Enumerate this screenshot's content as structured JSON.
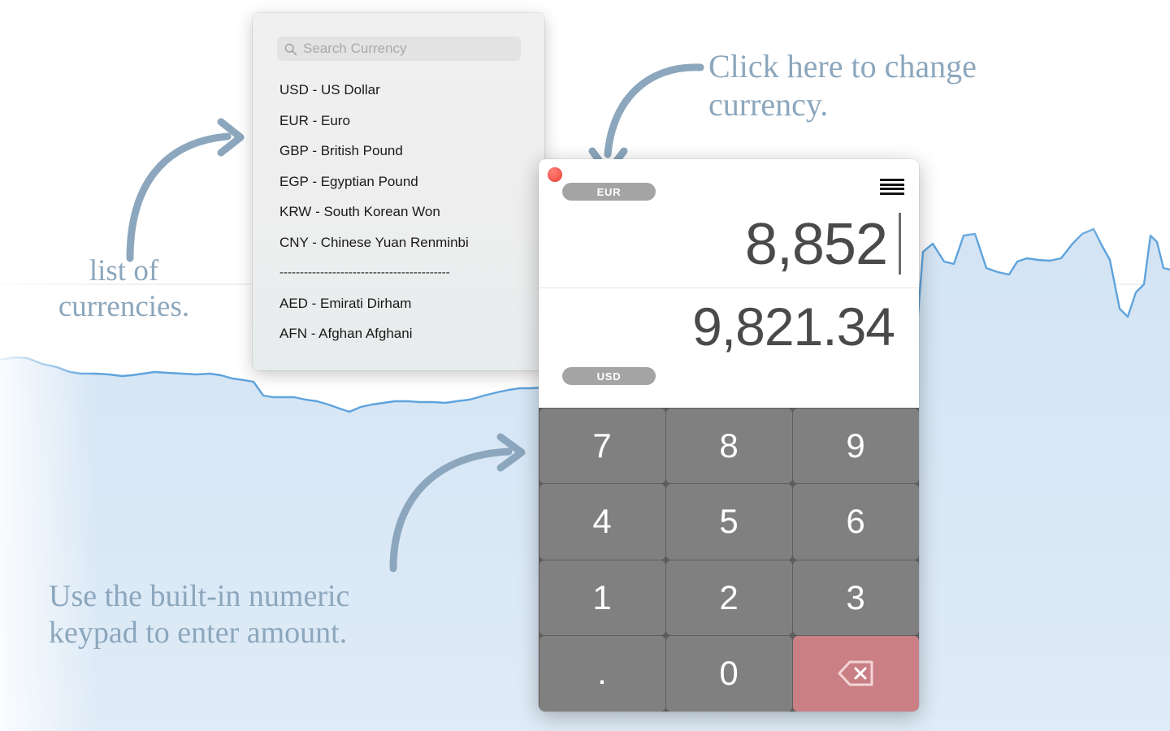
{
  "annotations": {
    "change_currency": "Click here to change\ncurrency.",
    "list_of_currencies": "list of\ncurrencies.",
    "keypad_hint": "Use the built-in numeric\nkeypad to enter amount.",
    "color": "#8ca7bd"
  },
  "popover": {
    "search": {
      "placeholder": "Search Currency",
      "value": "",
      "icon": "search-icon"
    },
    "items": [
      {
        "code": "USD",
        "label": "USD - US Dollar"
      },
      {
        "code": "EUR",
        "label": "EUR - Euro"
      },
      {
        "code": "GBP",
        "label": "GBP - British Pound"
      },
      {
        "code": "EGP",
        "label": "EGP - Egyptian Pound"
      },
      {
        "code": "KRW",
        "label": "KRW - South Korean Won"
      },
      {
        "code": "CNY",
        "label": "CNY - Chinese Yuan Renminbi"
      }
    ],
    "separator": "------------------------------------------",
    "items_after": [
      {
        "code": "AED",
        "label": "AED - Emirati Dirham"
      },
      {
        "code": "AFN",
        "label": "AFN - Afghan Afghani"
      }
    ]
  },
  "app": {
    "close_button": "close-button",
    "menu_icon": "hamburger-menu-icon",
    "top_currency": "EUR",
    "bottom_currency": "USD",
    "top_amount": "8,852",
    "bottom_amount": "9,821.34",
    "keypad": [
      {
        "name": "key-7",
        "label": "7",
        "type": "digit"
      },
      {
        "name": "key-8",
        "label": "8",
        "type": "digit"
      },
      {
        "name": "key-9",
        "label": "9",
        "type": "digit"
      },
      {
        "name": "key-4",
        "label": "4",
        "type": "digit"
      },
      {
        "name": "key-5",
        "label": "5",
        "type": "digit"
      },
      {
        "name": "key-6",
        "label": "6",
        "type": "digit"
      },
      {
        "name": "key-1",
        "label": "1",
        "type": "digit"
      },
      {
        "name": "key-2",
        "label": "2",
        "type": "digit"
      },
      {
        "name": "key-3",
        "label": "3",
        "type": "digit"
      },
      {
        "name": "key-decimal",
        "label": ".",
        "type": "dot"
      },
      {
        "name": "key-0",
        "label": "0",
        "type": "digit"
      },
      {
        "name": "key-backspace",
        "label": "",
        "type": "delete"
      }
    ],
    "colors": {
      "key_bg": "#808080",
      "delete_bg": "#c97f84",
      "pill_bg": "#a4a4a4",
      "close_red": "#f3554a",
      "amount_text": "#4a4a4a"
    }
  },
  "background": {
    "chart_line_color": "#5fa3dc",
    "chart_fill_color": "#d6e6f5"
  }
}
